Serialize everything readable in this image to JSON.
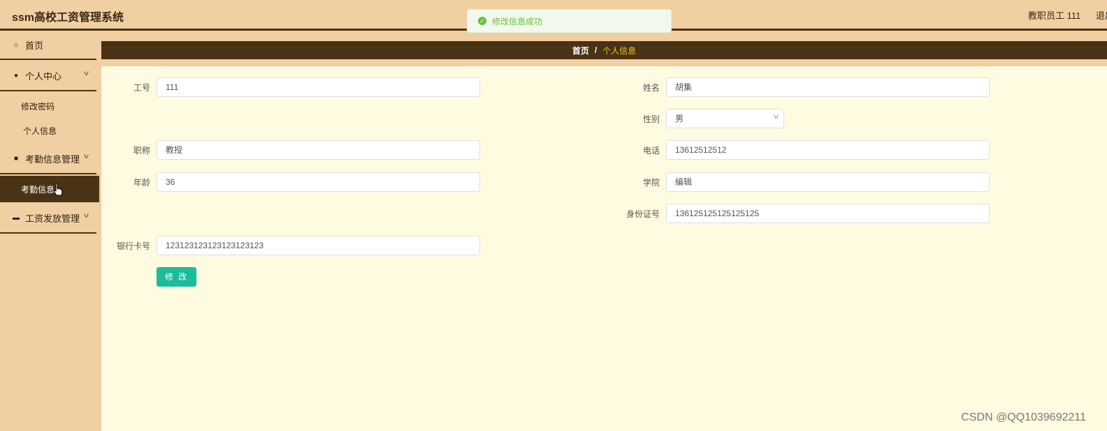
{
  "header": {
    "title": "ssm高校工资管理系统",
    "user": "教职员工 111",
    "logout": "退出"
  },
  "toast": {
    "message": "修改信息成功"
  },
  "sidebar": {
    "items": [
      {
        "label": "首页",
        "icon": "home-icon"
      },
      {
        "label": "个人中心",
        "icon": "user-icon"
      },
      {
        "label": "修改密码"
      },
      {
        "label": "个人信息"
      },
      {
        "label": "考勤信息管理",
        "icon": "checkbox-icon"
      },
      {
        "label": "考勤信息"
      },
      {
        "label": "工资发放管理",
        "icon": "briefcase-icon"
      }
    ]
  },
  "breadcrumb": {
    "home": "首页",
    "separator": "/",
    "current": "个人信息"
  },
  "form": {
    "gonghao": {
      "label": "工号",
      "value": "111"
    },
    "xingming": {
      "label": "姓名",
      "value": "胡集"
    },
    "xingbie": {
      "label": "性别",
      "value": "男"
    },
    "zhicheng": {
      "label": "职称",
      "value": "教授"
    },
    "dianhua": {
      "label": "电话",
      "value": "13612512512"
    },
    "nianling": {
      "label": "年龄",
      "value": "36"
    },
    "xueyuan": {
      "label": "学院",
      "value": "编辑"
    },
    "shenfenzheng": {
      "label": "身份证号",
      "value": "136125125125125125"
    },
    "yinhangka": {
      "label": "银行卡号",
      "value": "123123123123123123123"
    },
    "submit": "修 改"
  },
  "watermark": "CSDN @QQ1039692211",
  "colors": {
    "primary_dark": "#4a3214",
    "sidebar_bg": "#f0cfa3",
    "content_bg": "#fffbe0",
    "button": "#1abc9c",
    "breadcrumb_current": "#f5c518",
    "toast": "#67c23a"
  }
}
